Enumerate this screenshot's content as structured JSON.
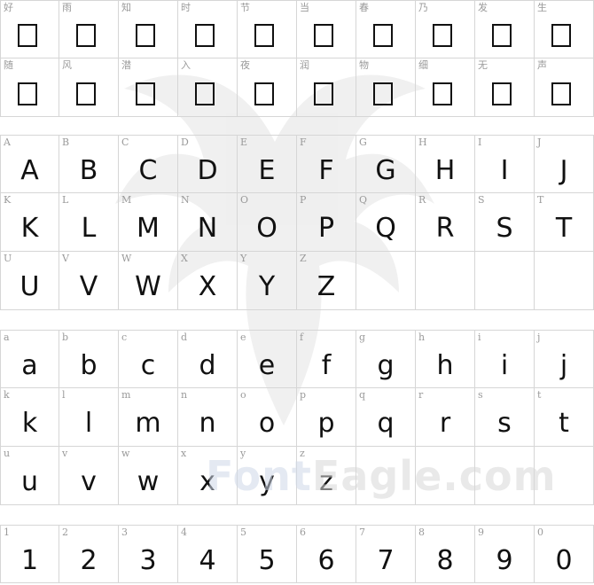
{
  "cjk_rows": [
    [
      "好",
      "雨",
      "知",
      "时",
      "节",
      "当",
      "春",
      "乃",
      "发",
      "生"
    ],
    [
      "随",
      "风",
      "潜",
      "入",
      "夜",
      "润",
      "物",
      "细",
      "无",
      "声"
    ]
  ],
  "upper_rows": [
    [
      "A",
      "B",
      "C",
      "D",
      "E",
      "F",
      "G",
      "H",
      "I",
      "J"
    ],
    [
      "K",
      "L",
      "M",
      "N",
      "O",
      "P",
      "Q",
      "R",
      "S",
      "T"
    ],
    [
      "U",
      "V",
      "W",
      "X",
      "Y",
      "Z"
    ]
  ],
  "lower_rows": [
    [
      "a",
      "b",
      "c",
      "d",
      "e",
      "f",
      "g",
      "h",
      "i",
      "j"
    ],
    [
      "k",
      "l",
      "m",
      "n",
      "o",
      "p",
      "q",
      "r",
      "s",
      "t"
    ],
    [
      "u",
      "v",
      "w",
      "x",
      "y",
      "z"
    ]
  ],
  "digit_row": [
    "1",
    "2",
    "3",
    "4",
    "5",
    "6",
    "7",
    "8",
    "9",
    "0"
  ],
  "watermark": {
    "brand_a": "Font",
    "brand_b": "Eagle.com"
  },
  "colors": {
    "grid_line": "#d6d6d6",
    "label": "#9a9a9a",
    "glyph": "#111111"
  }
}
